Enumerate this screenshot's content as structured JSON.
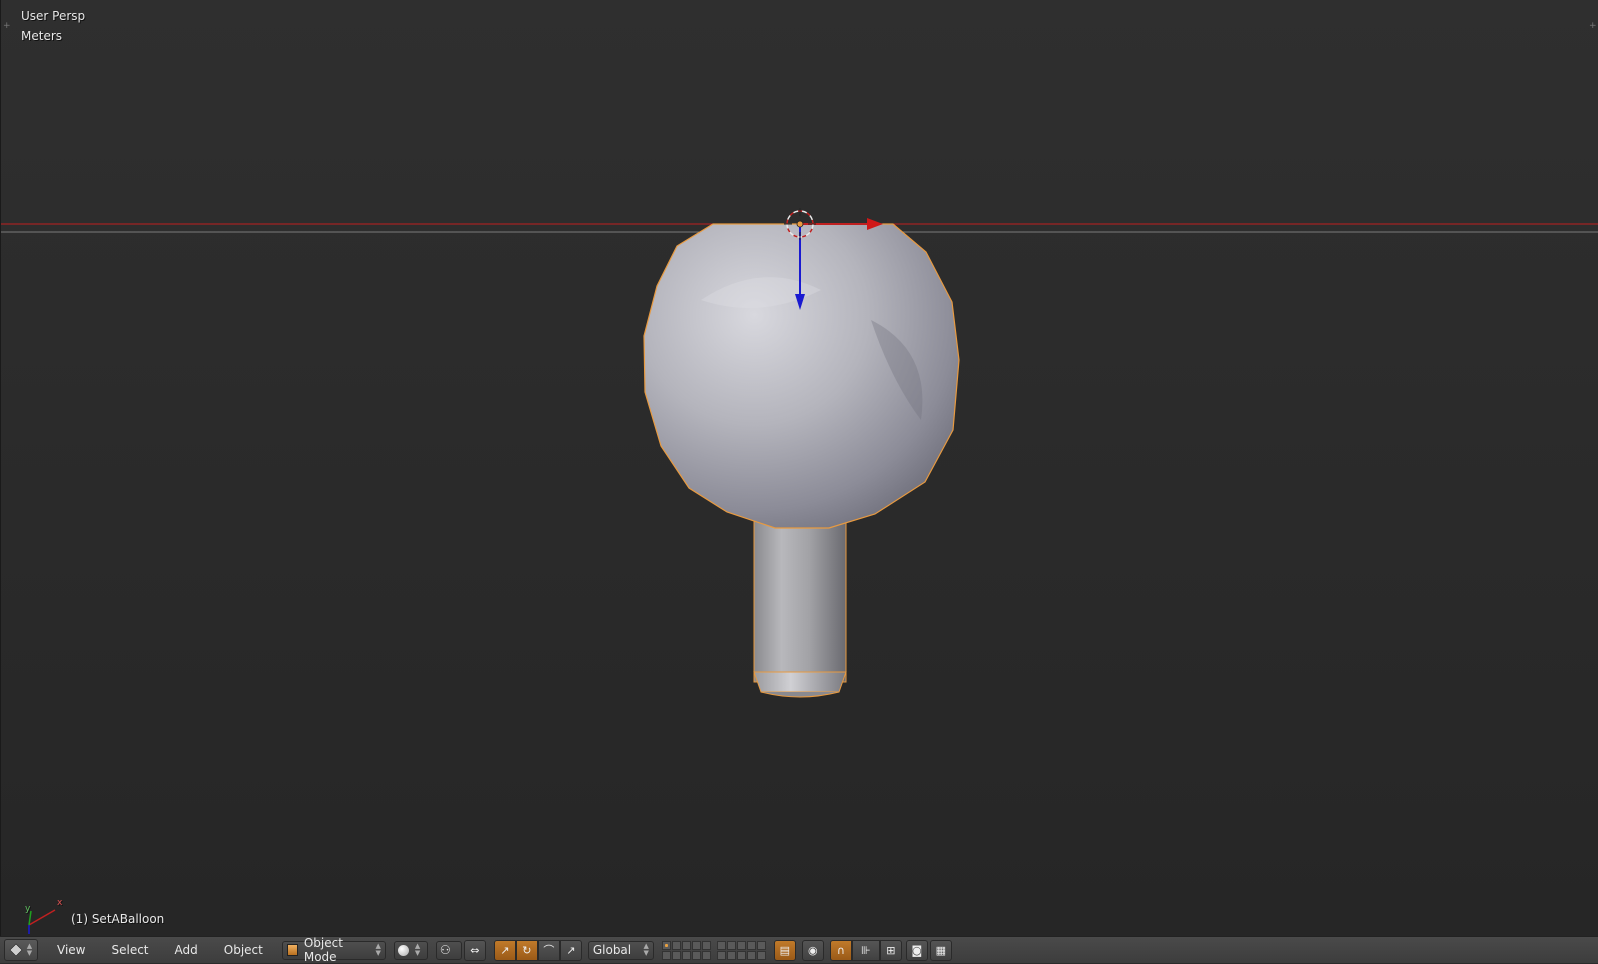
{
  "viewport": {
    "view_name": "User Persp",
    "units": "Meters",
    "object_info": "(1) SetABalloon",
    "mini_axis": {
      "x_label": "x",
      "y_label": "y"
    },
    "colors": {
      "x_axis": "#c02020",
      "z_axis": "#1a1ad0",
      "selection_outline": "#e89a40",
      "mesh": "#b8b8c0"
    }
  },
  "header": {
    "editor_type_icon": "3d-view-icon",
    "menus": [
      "View",
      "Select",
      "Add",
      "Object"
    ],
    "mode": {
      "label": "Object Mode",
      "icon": "cube-icon"
    },
    "viewport_shading_icon": "sphere-shading-icon",
    "pivot_icon": "pivot-point-icon",
    "orientation": "Global"
  }
}
